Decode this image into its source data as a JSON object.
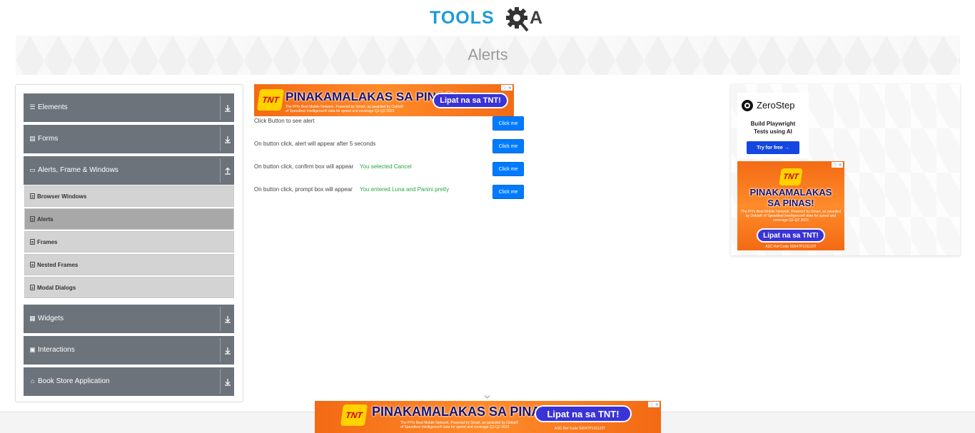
{
  "logo": {
    "text_tools": "TOOLS",
    "text_a": "A"
  },
  "banner": {
    "title": "Alerts"
  },
  "sidebar": {
    "groups": [
      {
        "label": "Elements",
        "icon": "menu-icon"
      },
      {
        "label": "Forms",
        "icon": "form-icon"
      },
      {
        "label": "Alerts, Frame & Windows",
        "icon": "window-icon",
        "expanded": true
      },
      {
        "label": "Widgets",
        "icon": "widgets-icon"
      },
      {
        "label": "Interactions",
        "icon": "interactions-icon"
      },
      {
        "label": "Book Store Application",
        "icon": "bookstore-icon"
      }
    ],
    "subitems": [
      {
        "label": "Browser Windows",
        "active": false
      },
      {
        "label": "Alerts",
        "active": true
      },
      {
        "label": "Frames",
        "active": false
      },
      {
        "label": "Nested Frames",
        "active": false
      },
      {
        "label": "Modal Dialogs",
        "active": false
      }
    ]
  },
  "alerts": {
    "rows": [
      {
        "label": "Click Button to see alert",
        "result": "",
        "button": "Click me"
      },
      {
        "label": "On button click, alert will appear after 5 seconds",
        "result": "",
        "button": "Click me"
      },
      {
        "label": "On button click, confirm box will appear",
        "result": "You selected Cancel",
        "button": "Click me"
      },
      {
        "label": "On button click, prompt box will appear",
        "result": "You entered Luna and Panini pretty",
        "button": "Click me"
      }
    ]
  },
  "ads": {
    "tnt_brand": "TNT",
    "tnt_headline": "PINAKAMALAKAS SA PINAS!",
    "tnt_headline_line1": "PINAKAMALAKAS",
    "tnt_headline_line2": "SA PINAS!",
    "tnt_cta": "Lipat na sa TNT!",
    "tnt_fine_print_1": "The PH's Best Mobile Network. Powered by Smart, as awarded by Ookla®",
    "tnt_fine_print_2": "of Speedtest Intelligence® data for speed and coverage Q1-Q2 2023",
    "tnt_fine_print": "The PH's Best Mobile Network. Powered by Smart, as awarded by Ookla® of Speedtest Intelligence® data for speed and coverage Q1-Q2 2023",
    "tnt_ref": "ASC Ref Code S0047P101123T",
    "zerostep_name": "ZeroStep",
    "zerostep_tagline": "Build Playwright Tests using AI",
    "zerostep_cta": "Try for free →"
  },
  "colors": {
    "primary_button": "#007bff",
    "sidebar_group": "#6c737b",
    "result_text": "#28a745",
    "logo_blue": "#1d9bd9"
  }
}
